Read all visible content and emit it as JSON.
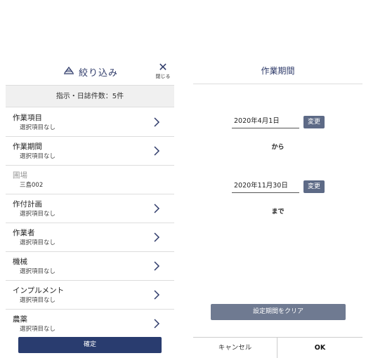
{
  "filter": {
    "title": "絞り込み",
    "close_label": "閉じる",
    "count_text": "指示・日誌件数：5件",
    "items": [
      {
        "title": "作業項目",
        "sub": "選択項目なし",
        "disabled": false
      },
      {
        "title": "作業期間",
        "sub": "選択項目なし",
        "disabled": false
      },
      {
        "title": "圃場",
        "sub": "三島002",
        "disabled": true
      },
      {
        "title": "作付計画",
        "sub": "選択項目なし",
        "disabled": false
      },
      {
        "title": "作業者",
        "sub": "選択項目なし",
        "disabled": false
      },
      {
        "title": "機械",
        "sub": "選択項目なし",
        "disabled": false
      },
      {
        "title": "インプルメント",
        "sub": "選択項目なし",
        "disabled": false
      },
      {
        "title": "農薬",
        "sub": "選択項目なし",
        "disabled": false
      }
    ],
    "confirm_label": "確定"
  },
  "period": {
    "title": "作業期間",
    "start_date": "2020年4月1日",
    "end_date": "2020年11月30日",
    "change_label": "変更",
    "from_label": "から",
    "until_label": "まで",
    "clear_label": "設定期間をクリア",
    "cancel_label": "キャンセル",
    "ok_label": "OK"
  },
  "colors": {
    "primary": "#293c6f",
    "secondary_button": "#5d6a86",
    "title_text": "#2f3b6a"
  },
  "icons": {
    "filter_title": "scale-icon",
    "close": "close-icon",
    "row_action": "chevron-right-icon"
  }
}
